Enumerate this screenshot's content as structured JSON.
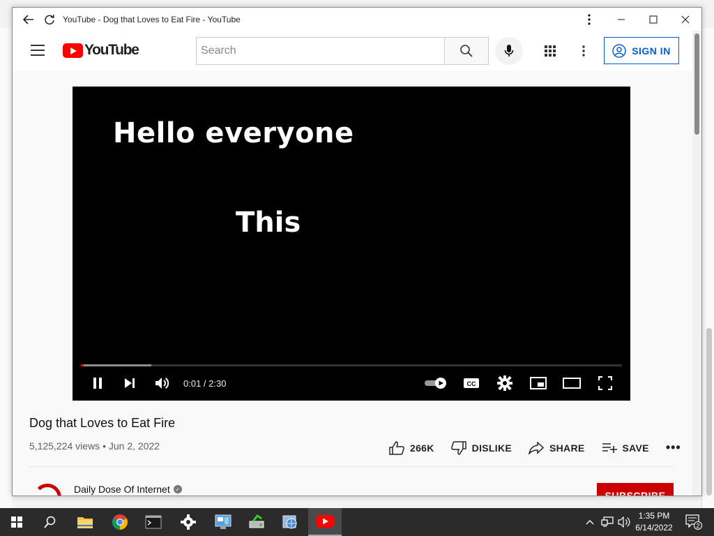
{
  "window": {
    "title": "YouTube - Dog that Loves to Eat Fire - YouTube",
    "controls": {
      "menu": "more-options",
      "minimize": "minimize",
      "maximize": "maximize",
      "close": "close"
    }
  },
  "header": {
    "logo_text": "YouTube",
    "search": {
      "placeholder": "Search",
      "value": ""
    },
    "sign_in_label": "SIGN IN"
  },
  "player": {
    "captions": [
      "Hello everyone",
      "This"
    ],
    "time_display": "0:01 / 2:30",
    "progress": {
      "played_fraction": 0.004,
      "loaded_fraction": 0.13
    },
    "autoplay": true
  },
  "video": {
    "title": "Dog that Loves to Eat Fire",
    "views_line": "5,125,224 views • Jun 2, 2022",
    "actions": {
      "like_count": "266K",
      "dislike_label": "DISLIKE",
      "share_label": "SHARE",
      "save_label": "SAVE",
      "more_label": "•••"
    }
  },
  "channel": {
    "name": "Daily Dose Of Internet",
    "verified": true,
    "subscribe_label": "SUBSCRIBE"
  },
  "taskbar": {
    "apps": [
      "start",
      "search",
      "file-explorer",
      "chrome",
      "terminal",
      "settings",
      "control-panel",
      "disk-utility",
      "network-app",
      "youtube"
    ],
    "clock": {
      "time": "1:35 PM",
      "date": "6/14/2022"
    },
    "notification_count": "2"
  },
  "colors": {
    "youtube_red": "#ff0000",
    "link_blue": "#065fd4",
    "subscribe_red": "#cc0000",
    "taskbar": "#2b2b2b"
  }
}
